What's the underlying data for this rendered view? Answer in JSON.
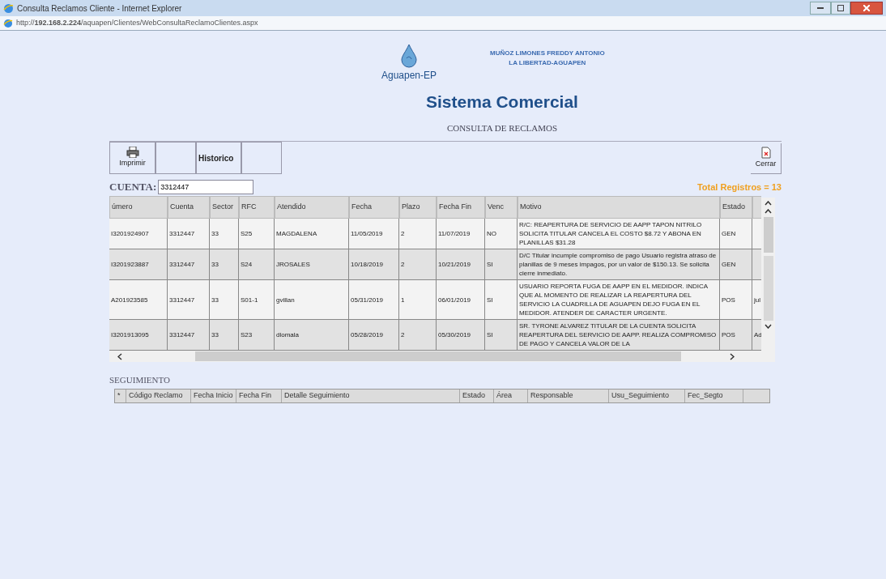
{
  "window": {
    "title": "Consulta Reclamos Cliente - Internet Explorer",
    "address": "http://**192.168.2.224**/aquapen/Clientes/WebConsultaReclamoClientes.aspx"
  },
  "header": {
    "logo_text": "Aguapen-EP",
    "user_name": "MUÑOZ LIMONES FREDDY ANTONIO",
    "user_location": "LA LIBERTAD-AGUAPEN",
    "title": "Sistema Comercial",
    "subtitle": "CONSULTA DE RECLAMOS"
  },
  "toolbar": {
    "left": [
      {
        "kind": "print",
        "label": "Imprimir"
      },
      {
        "kind": "text",
        "label": "Historico"
      }
    ],
    "close": {
      "label": "Cerrar"
    }
  },
  "search": {
    "label": "CUENTA:",
    "value": "3312447"
  },
  "total": "Total Registros = 13",
  "reclamos": {
    "columns": [
      "úmero",
      "Cuenta",
      "Sector",
      "RFC",
      "Atendido",
      "Fecha",
      "Plazo",
      "Fecha Fin",
      "Venc",
      "Motivo",
      "Estado"
    ],
    "rows": [
      [
        "I3201924907",
        "3312447",
        "33",
        "S25",
        "MAGDALENA",
        "11/05/2019",
        "2",
        "11/07/2019",
        "NO",
        "R/C: REAPERTURA DE SERVICIO DE AAPP TAPON NITRILO SOLICITA TITULAR CANCELA EL COSTO $8.72 Y ABONA EN PLANILLAS $31.28",
        "GEN",
        ""
      ],
      [
        "I3201923887",
        "3312447",
        "33",
        "S24",
        "JROSALES",
        "10/18/2019",
        "2",
        "10/21/2019",
        "SI",
        "D/C Titular incumple compromiso de pago Usuario registra atraso de planillas de 9 meses impagos, por un valor de $150.13. Se solicita cierre inmediato.",
        "GEN",
        ""
      ],
      [
        "A201923585",
        "3312447",
        "33",
        "S01-1",
        "gvillan",
        "05/31/2019",
        "1",
        "06/01/2019",
        "SI",
        "USUARIO REPORTA FUGA DE AAPP EN EL MEDIDOR. INDICA QUE AL MOMENTO DE REALIZAR LA REAPERTURA DEL SERVICIO LA CUADRILLA DE AGUAPEN DEJO FUGA EN EL MEDIDOR. ATENDER DE CARACTER URGENTE.",
        "POS",
        "jul"
      ],
      [
        "I3201913095",
        "3312447",
        "33",
        "S23",
        "dlomala",
        "05/28/2019",
        "2",
        "05/30/2019",
        "SI",
        "SR. TYRONE ALVAREZ TITULAR DE LA CUENTA SOLICITA REAPERTURA DEL SERVICIO DE AAPP. REALIZA COMPROMISO DE PAGO Y CANCELA VALOR DE LA",
        "POS",
        "Ad"
      ]
    ]
  },
  "seguimiento": {
    "title": "SEGUIMIENTO",
    "columns": [
      "*",
      "Código Reclamo",
      "Fecha Inicio",
      "Fecha Fin",
      "Detalle Seguimiento",
      "Estado",
      "Área",
      "Responsable",
      "Usu_Seguimiento",
      "Fec_Segto"
    ]
  }
}
